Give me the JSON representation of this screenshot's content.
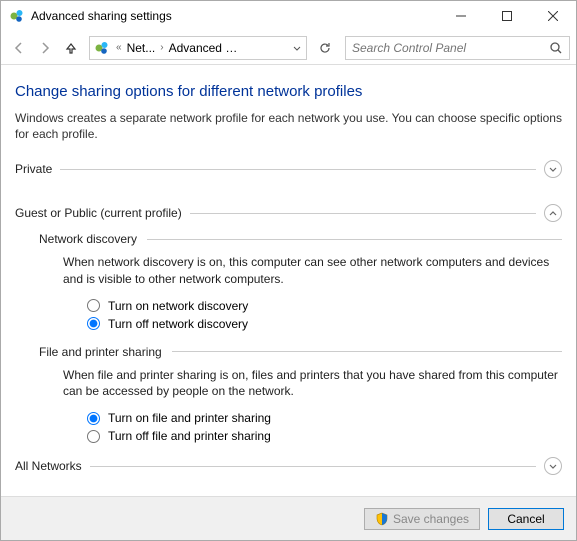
{
  "window": {
    "title": "Advanced sharing settings"
  },
  "breadcrumb": {
    "item1": "Net...",
    "item2": "Advanced sh..."
  },
  "search": {
    "placeholder": "Search Control Panel"
  },
  "page": {
    "title": "Change sharing options for different network profiles",
    "description": "Windows creates a separate network profile for each network you use. You can choose specific options for each profile."
  },
  "sections": {
    "private": {
      "label": "Private"
    },
    "guest": {
      "label": "Guest or Public (current profile)"
    },
    "all": {
      "label": "All Networks"
    }
  },
  "network_discovery": {
    "title": "Network discovery",
    "description": "When network discovery is on, this computer can see other network computers and devices and is visible to other network computers.",
    "option_on": "Turn on network discovery",
    "option_off": "Turn off network discovery",
    "selected": "off"
  },
  "file_printer": {
    "title": "File and printer sharing",
    "description": "When file and printer sharing is on, files and printers that you have shared from this computer can be accessed by people on the network.",
    "option_on": "Turn on file and printer sharing",
    "option_off": "Turn off file and printer sharing",
    "selected": "on"
  },
  "footer": {
    "save": "Save changes",
    "cancel": "Cancel"
  }
}
